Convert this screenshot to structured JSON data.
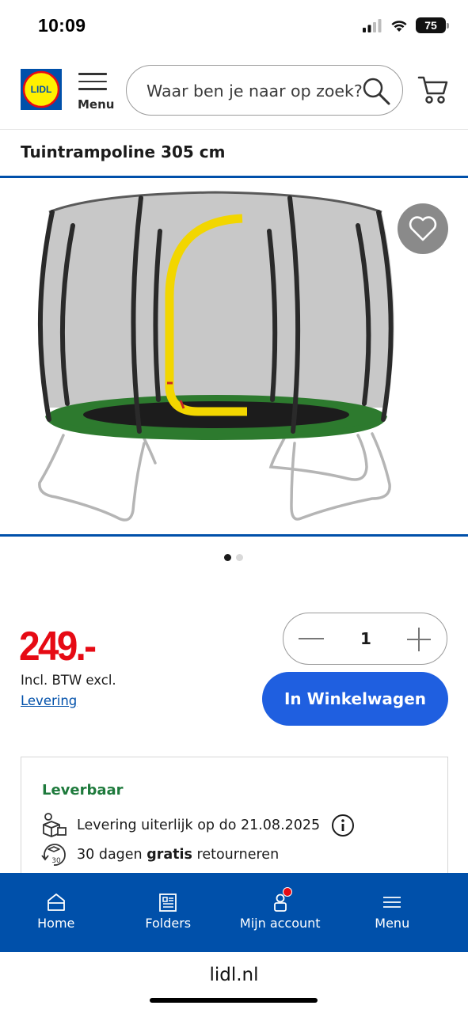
{
  "status_bar": {
    "time": "10:09",
    "battery": "75",
    "icons": [
      "signal-icon",
      "wifi-icon",
      "battery-icon"
    ]
  },
  "header": {
    "logo_text": "LIDL",
    "menu_label": "Menu",
    "search_placeholder": "Waar ben je naar op zoek?",
    "icons": [
      "menu-icon",
      "search-icon",
      "cart-icon"
    ]
  },
  "product": {
    "title": "Tuintrampoline 305 cm",
    "image_count": 2,
    "active_image": 1,
    "favorite_icon": "heart-icon",
    "price": "249.-",
    "price_note": "Incl. BTW excl.",
    "delivery_link": "Levering",
    "quantity": "1",
    "add_to_cart_label": "In Winkelwagen"
  },
  "availability": {
    "status": "Leverbaar",
    "delivery_text": "Levering uiterlijk op do 21.08.2025",
    "returns_prefix": "30 dagen ",
    "returns_bold": "gratis",
    "returns_suffix": " retourneren"
  },
  "bottom_nav": {
    "items": [
      {
        "label": "Home",
        "icon": "home-icon"
      },
      {
        "label": "Folders",
        "icon": "folders-icon"
      },
      {
        "label": "Mijn account",
        "icon": "account-icon"
      },
      {
        "label": "Menu",
        "icon": "menu-icon"
      }
    ]
  },
  "browser": {
    "url": "lidl.nl"
  },
  "colors": {
    "brand_blue": "#0050aa",
    "cta_blue": "#1f5fe0",
    "price_red": "#e60a14",
    "available_green": "#1e7a3c",
    "logo_yellow": "#fff000"
  }
}
